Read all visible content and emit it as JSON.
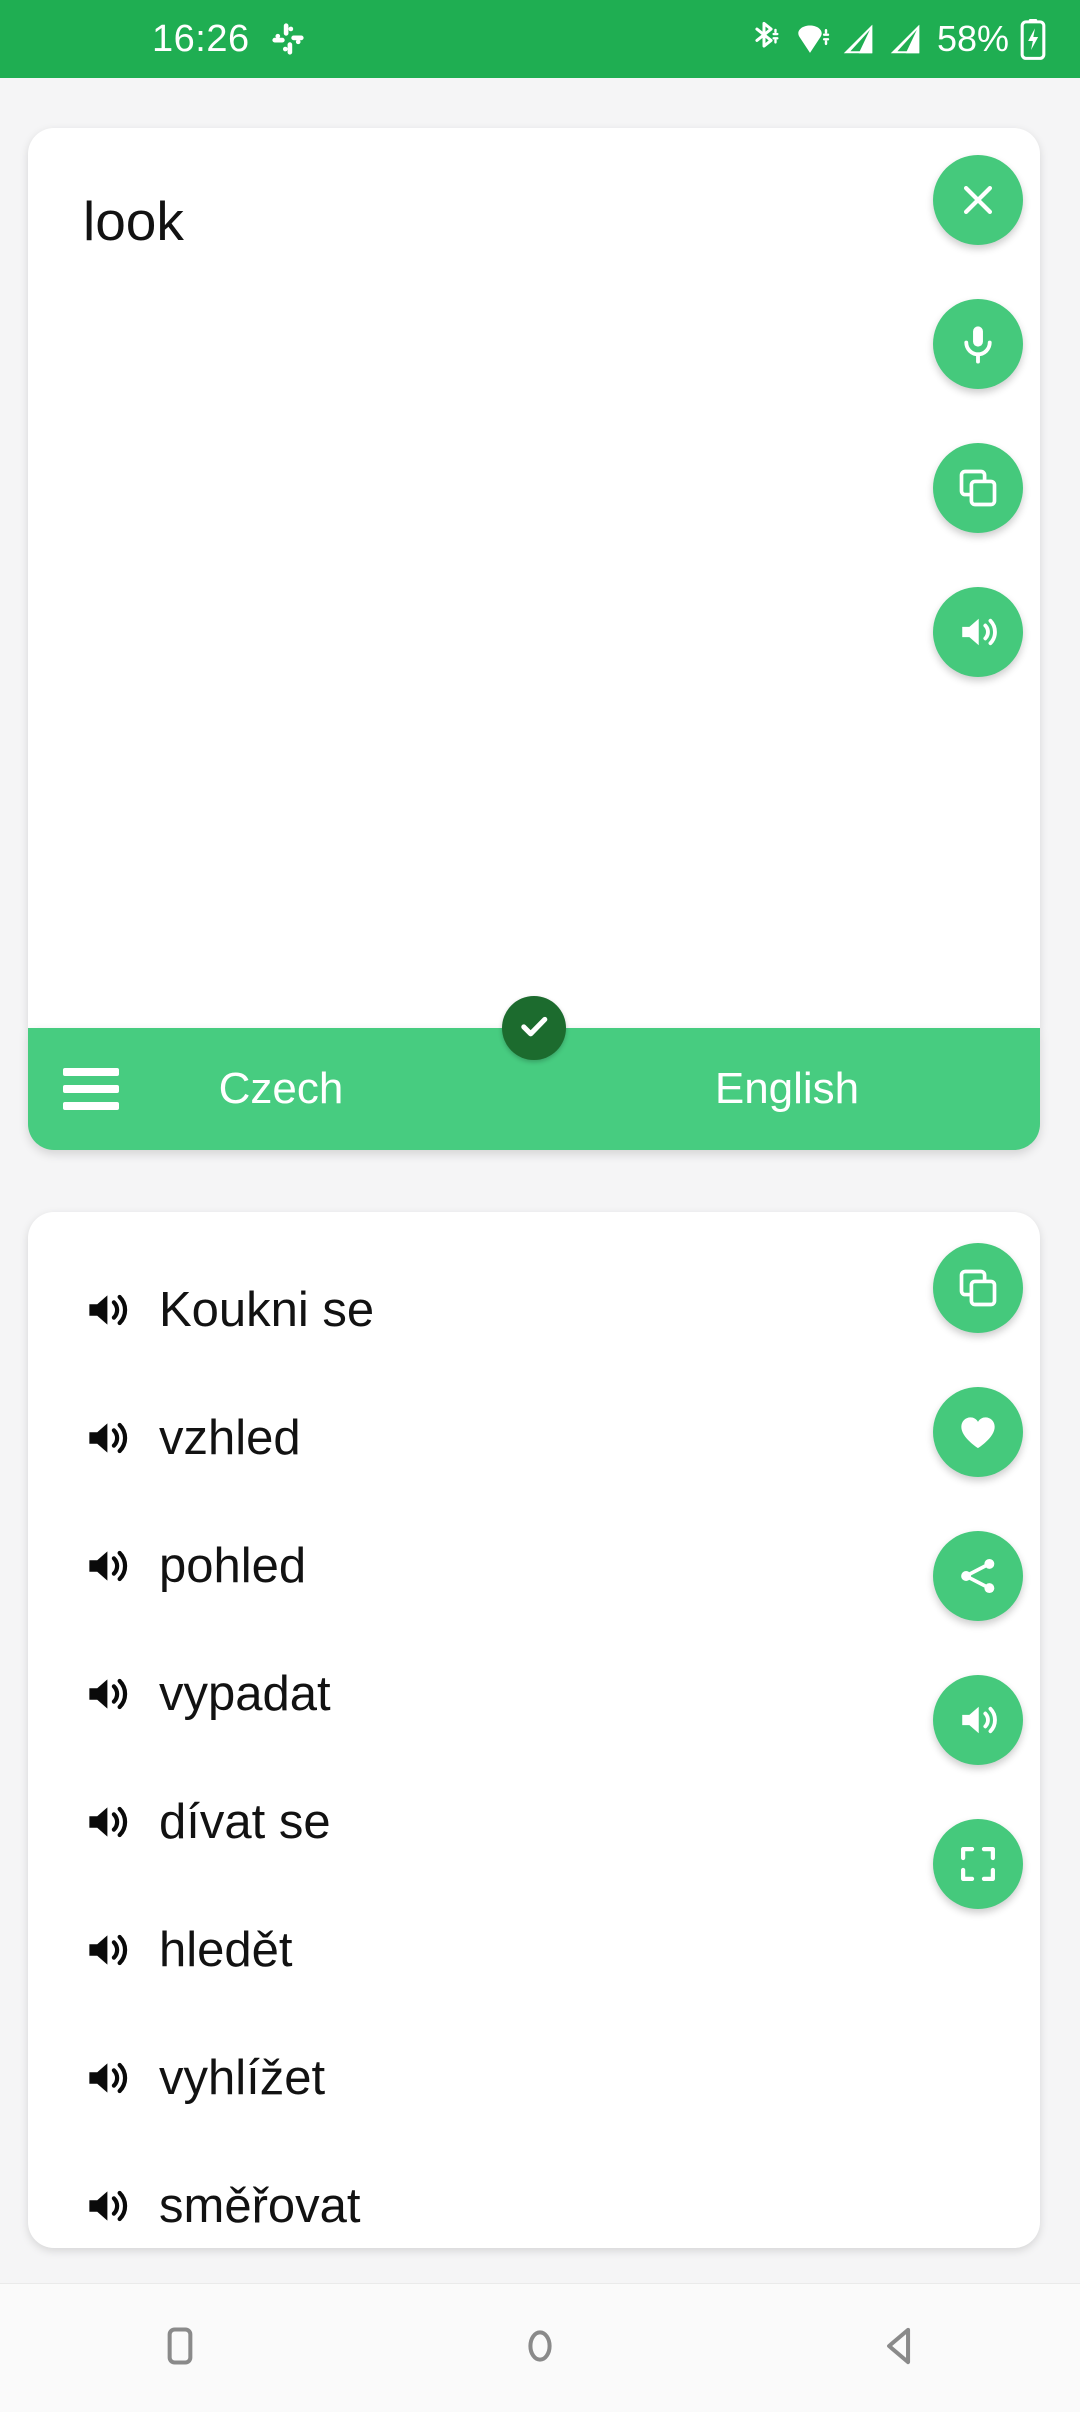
{
  "status_bar": {
    "time": "16:26",
    "battery_percent": "58%",
    "icons": [
      "slack-icon",
      "bluetooth-icon",
      "wifi-icon",
      "signal-sim1-icon",
      "signal-sim2-icon",
      "battery-charging-icon"
    ],
    "background_color": "#1FAE52",
    "foreground_color": "#FFFFFF"
  },
  "input_card": {
    "text": "look",
    "actions": [
      {
        "name": "close-button",
        "icon": "close-icon"
      },
      {
        "name": "microphone-button",
        "icon": "microphone-icon"
      },
      {
        "name": "copy-button",
        "icon": "copy-icon"
      },
      {
        "name": "speak-button",
        "icon": "speaker-icon"
      }
    ]
  },
  "language_bar": {
    "menu_icon": "hamburger-menu-icon",
    "source_language": "Czech",
    "target_language": "English",
    "selected_badge_icon": "check-icon",
    "background_color": "#47CC80",
    "badge_color": "#1C6B2E"
  },
  "results_card": {
    "items": [
      {
        "text": "Koukni se",
        "icon": "speaker-icon"
      },
      {
        "text": "vzhled",
        "icon": "speaker-icon"
      },
      {
        "text": "pohled",
        "icon": "speaker-icon"
      },
      {
        "text": "vypadat",
        "icon": "speaker-icon"
      },
      {
        "text": "dívat se",
        "icon": "speaker-icon"
      },
      {
        "text": "hledět",
        "icon": "speaker-icon"
      },
      {
        "text": "vyhlížet",
        "icon": "speaker-icon"
      },
      {
        "text": "směřovat",
        "icon": "speaker-icon"
      }
    ],
    "actions": [
      {
        "name": "copy-button",
        "icon": "copy-icon"
      },
      {
        "name": "favorite-button",
        "icon": "heart-icon"
      },
      {
        "name": "share-button",
        "icon": "share-icon"
      },
      {
        "name": "speak-button",
        "icon": "speaker-icon"
      },
      {
        "name": "fullscreen-button",
        "icon": "fullscreen-icon"
      }
    ]
  },
  "nav_bar": {
    "buttons": [
      {
        "name": "recents-button",
        "icon": "square-icon"
      },
      {
        "name": "home-button",
        "icon": "circle-icon"
      },
      {
        "name": "back-button",
        "icon": "triangle-left-icon"
      }
    ]
  },
  "theme": {
    "accent": "#45C97C",
    "status_green": "#1FAE52",
    "bar_green": "#47CC80",
    "badge_green": "#1C6B2E",
    "page_background": "#F5F5F6",
    "card_background": "#FFFFFF"
  }
}
